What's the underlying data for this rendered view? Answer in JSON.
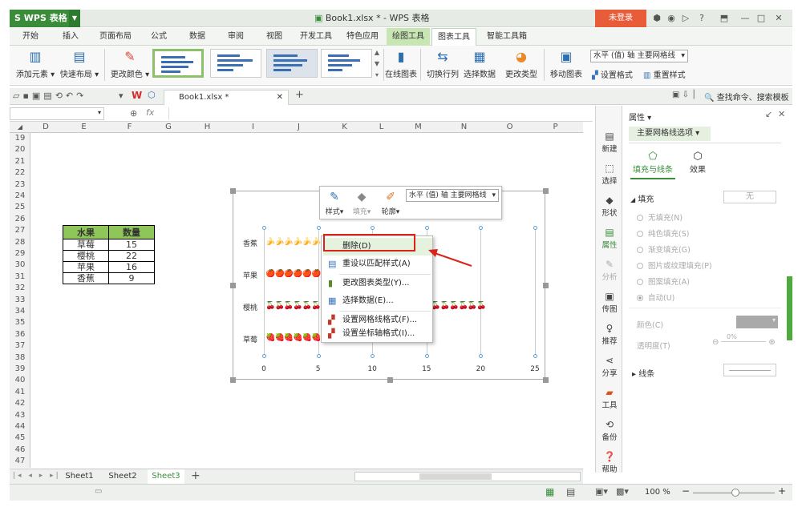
{
  "app": {
    "name": "WPS 表格",
    "doc_title": "Book1.xlsx * - WPS 表格",
    "login": "未登录",
    "help": "?"
  },
  "menu": {
    "tabs": [
      "开始",
      "插入",
      "页面布局",
      "公式",
      "数据",
      "审阅",
      "视图",
      "开发工具",
      "特色应用",
      "绘图工具",
      "图表工具",
      "智能工具箱"
    ]
  },
  "ribbon": {
    "add_element": "添加元素",
    "quick_layout": "快速布局",
    "change_color": "更改颜色",
    "online_chart": "在线图表",
    "switch_row_col": "切换行列",
    "select_data": "选择数据",
    "change_type": "更改类型",
    "move_chart": "移动图表",
    "selector_value": "水平 (值) 轴 主要网格线",
    "set_format": "设置格式",
    "reset_style": "重置样式"
  },
  "tabstrip": {
    "doc_tab": "Book1.xlsx *",
    "search": "查找命令、搜索模板"
  },
  "formula": {
    "fx": "fx"
  },
  "columns": [
    "D",
    "E",
    "F",
    "G",
    "H",
    "I",
    "J",
    "K",
    "L",
    "M",
    "N",
    "O",
    "P"
  ],
  "rows": [
    "19",
    "20",
    "21",
    "22",
    "23",
    "24",
    "25",
    "26",
    "27",
    "28",
    "29",
    "30",
    "31",
    "32",
    "33",
    "34",
    "35",
    "36",
    "37",
    "38",
    "39",
    "40",
    "41",
    "42",
    "43",
    "44",
    "45",
    "46",
    "47"
  ],
  "table": {
    "headers": [
      "水果",
      "数量"
    ],
    "rows": [
      [
        "草莓",
        "15"
      ],
      [
        "樱桃",
        "22"
      ],
      [
        "苹果",
        "16"
      ],
      [
        "香蕉",
        "9"
      ]
    ]
  },
  "chart_data": {
    "type": "bar",
    "categories": [
      "草莓",
      "樱桃",
      "苹果",
      "香蕉"
    ],
    "values": [
      15,
      22,
      16,
      9
    ],
    "xticks": [
      "0",
      "5",
      "10",
      "15",
      "20",
      "25"
    ],
    "xlim": [
      0,
      25
    ],
    "icons": {
      "香蕉": "🍌",
      "苹果": "🍎",
      "樱桃": "🍒",
      "草莓": "🍓"
    },
    "grid": true
  },
  "minitoolbar": {
    "style": "样式",
    "fill": "填充",
    "outline": "轮廓",
    "selector": "水平 (值) 轴 主要网格线"
  },
  "context_menu": {
    "items": [
      "删除(D)",
      "重设以匹配样式(A)",
      "更改图表类型(Y)...",
      "选择数据(E)...",
      "设置网格线格式(F)...",
      "设置坐标轴格式(I)..."
    ]
  },
  "sheets": [
    "Sheet1",
    "Sheet2",
    "Sheet3"
  ],
  "status": {
    "zoom": "100 %"
  },
  "iconbar": [
    "新建",
    "选择",
    "形状",
    "属性",
    "分析",
    "传图",
    "推荐",
    "分享",
    "工具",
    "备份",
    "帮助"
  ],
  "panel": {
    "title": "属性",
    "dropdown": "主要网格线选项",
    "tab_fill": "填充与线条",
    "tab_effect": "效果",
    "fill_section": "填充",
    "fill_value": "无",
    "options": [
      "无填充(N)",
      "纯色填充(S)",
      "渐变填充(G)",
      "图片或纹理填充(P)",
      "图案填充(A)",
      "自动(U)"
    ],
    "color": "颜色(C)",
    "transparency": "透明度(T)",
    "transparency_value": "0%",
    "line": "线条"
  },
  "colors": {
    "accent": "#3a8c3a",
    "table_header": "#8ec65a",
    "highlight_box": "#d9241c"
  }
}
